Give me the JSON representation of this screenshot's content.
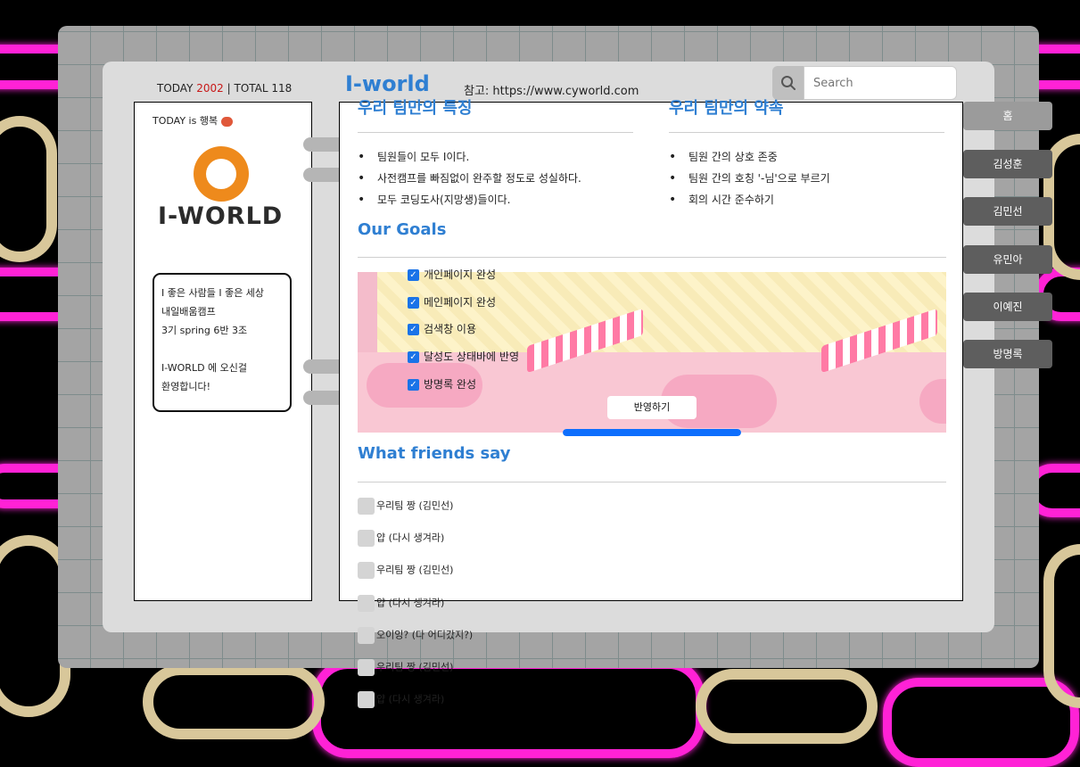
{
  "header": {
    "counter": {
      "today_label": "TODAY",
      "today_value": "2002",
      "separator": "|",
      "total_label": "TOTAL",
      "total_value": "118"
    },
    "site_title": "I-world",
    "reference": "참고: https://www.cyworld.com",
    "search": {
      "placeholder": "Search"
    }
  },
  "profile": {
    "mood_text": "TODAY is 행복",
    "logo_text": "I-WORLD",
    "intro_lines": [
      "I 좋은 사람들 I 좋은 세상",
      "내일배움캠프",
      "3기 spring 6반 3조",
      "",
      "I-WORLD 에 오신걸",
      "환영합니다!"
    ]
  },
  "features": {
    "title": "우리 팀만의 특징",
    "items": [
      "팀원들이 모두 I이다.",
      "사전캠프를 빠짐없이 완주할 정도로 성실하다.",
      "모두 코딩도사(지망생)들이다."
    ]
  },
  "promise": {
    "title": "우리 팀만의 약속",
    "items": [
      "팀원 간의 상호 존중",
      "팀원 간의 호칭 '-님'으로 부르기",
      "회의 시간 준수하기"
    ]
  },
  "goals": {
    "title": "Our Goals",
    "items": [
      "개인페이지 완성",
      "메인페이지 완성",
      "검색창 이용",
      "달성도 상태바에 반영",
      "방명록 완성"
    ],
    "apply_label": "반영하기",
    "progress": 1.0
  },
  "friends": {
    "title": "What friends say",
    "comments": [
      "우리팀 짱 (김민선)",
      "얍 (다시 생겨라)",
      "우리팀 짱 (김민선)",
      "얍 (다시 생겨라)",
      "오이잉? (다 어디갔지?)",
      "우리팀 짱 (김민선)",
      "얍 (다시 생겨라)"
    ]
  },
  "menu": {
    "items": [
      "홈",
      "김성훈",
      "김민선",
      "유민아",
      "이예진",
      "방명록"
    ]
  },
  "colors": {
    "accent_blue": "#2f7fd2",
    "today_red": "#c81818",
    "logo_orange": "#ee8a1c",
    "progress_blue": "#0d6efd"
  }
}
